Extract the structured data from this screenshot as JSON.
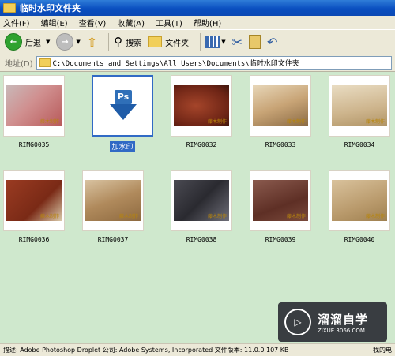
{
  "window": {
    "title": "临时水印文件夹"
  },
  "menu": [
    "文件(F)",
    "编辑(E)",
    "查看(V)",
    "收藏(A)",
    "工具(T)",
    "帮助(H)"
  ],
  "toolbar": {
    "back_label": "后退",
    "search_label": "搜索",
    "folders_label": "文件夹"
  },
  "address": {
    "label": "地址(D)",
    "path": "C:\\Documents and Settings\\All Users\\Documents\\临时水印文件夹"
  },
  "items": [
    {
      "name": "RIMG0035",
      "wm": "藤木制作"
    },
    {
      "name": "加水印"
    },
    {
      "name": "RIMG0032",
      "wm": "藤木制作"
    },
    {
      "name": "RIMG0033",
      "wm": "藤木制作"
    },
    {
      "name": "RIMG0034",
      "wm": "藤木制作"
    },
    {
      "name": "RIMG0036",
      "wm": "藤木制作"
    },
    {
      "name": "RIMG0037",
      "wm": "藤木制作"
    },
    {
      "name": "RIMG0038",
      "wm": "藤木制作"
    },
    {
      "name": "RIMG0039",
      "wm": "藤木制作"
    },
    {
      "name": "RIMG0040",
      "wm": "藤木制作"
    }
  ],
  "status": {
    "text": "描述: Adobe Photoshop Droplet 公司: Adobe Systems, Incorporated 文件版本: 11.0.0 107 KB",
    "right": "我的电"
  },
  "overlay": {
    "brand": "溜溜自学",
    "site": "ZIXUE.3066.COM"
  }
}
